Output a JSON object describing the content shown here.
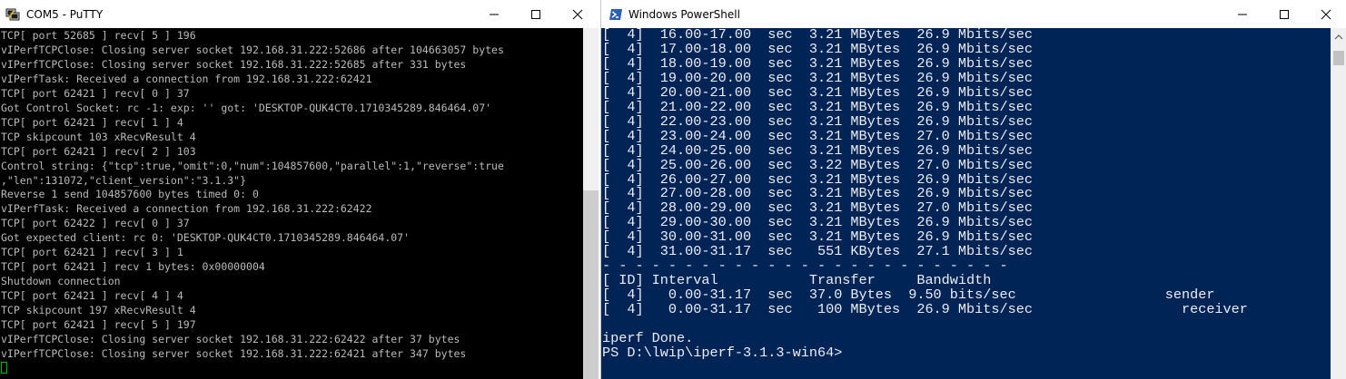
{
  "putty": {
    "title": "COM5 - PuTTY",
    "lines": [
      "TCP[ port 52685 ] recv[ 5 ] 196",
      "vIPerfTCPClose: Closing server socket 192.168.31.222:52686 after 104663057 bytes",
      "vIPerfTCPClose: Closing server socket 192.168.31.222:52685 after 331 bytes",
      "vIPerfTask: Received a connection from 192.168.31.222:62421",
      "TCP[ port 62421 ] recv[ 0 ] 37",
      "Got Control Socket: rc -1: exp: '' got: 'DESKTOP-QUK4CT0.1710345289.846464.07'",
      "TCP[ port 62421 ] recv[ 1 ] 4",
      "TCP skipcount 103 xRecvResult 4",
      "TCP[ port 62421 ] recv[ 2 ] 103",
      "Control string: {\"tcp\":true,\"omit\":0,\"num\":104857600,\"parallel\":1,\"reverse\":true",
      ",\"len\":131072,\"client_version\":\"3.1.3\"}",
      "Reverse 1 send 104857600 bytes timed 0: 0",
      "vIPerfTask: Received a connection from 192.168.31.222:62422",
      "TCP[ port 62422 ] recv[ 0 ] 37",
      "Got expected client: rc 0: 'DESKTOP-QUK4CT0.1710345289.846464.07'",
      "TCP[ port 62421 ] recv[ 3 ] 1",
      "TCP[ port 62421 ] recv 1 bytes: 0x00000004",
      "Shutdown connection",
      "TCP[ port 62421 ] recv[ 4 ] 4",
      "TCP skipcount 197 xRecvResult 4",
      "TCP[ port 62421 ] recv[ 5 ] 197",
      "vIPerfTCPClose: Closing server socket 192.168.31.222:62422 after 37 bytes",
      "vIPerfTCPClose: Closing server socket 192.168.31.222:62421 after 347 bytes"
    ]
  },
  "powershell": {
    "title": "Windows PowerShell",
    "lines": [
      "[  4]  16.00-17.00  sec  3.21 MBytes  26.9 Mbits/sec",
      "[  4]  17.00-18.00  sec  3.21 MBytes  26.9 Mbits/sec",
      "[  4]  18.00-19.00  sec  3.21 MBytes  26.9 Mbits/sec",
      "[  4]  19.00-20.00  sec  3.21 MBytes  26.9 Mbits/sec",
      "[  4]  20.00-21.00  sec  3.21 MBytes  26.9 Mbits/sec",
      "[  4]  21.00-22.00  sec  3.21 MBytes  26.9 Mbits/sec",
      "[  4]  22.00-23.00  sec  3.21 MBytes  26.9 Mbits/sec",
      "[  4]  23.00-24.00  sec  3.21 MBytes  27.0 Mbits/sec",
      "[  4]  24.00-25.00  sec  3.21 MBytes  26.9 Mbits/sec",
      "[  4]  25.00-26.00  sec  3.22 MBytes  27.0 Mbits/sec",
      "[  4]  26.00-27.00  sec  3.21 MBytes  26.9 Mbits/sec",
      "[  4]  27.00-28.00  sec  3.21 MBytes  26.9 Mbits/sec",
      "[  4]  28.00-29.00  sec  3.21 MBytes  27.0 Mbits/sec",
      "[  4]  29.00-30.00  sec  3.21 MBytes  26.9 Mbits/sec",
      "[  4]  30.00-31.00  sec  3.21 MBytes  26.9 Mbits/sec",
      "[  4]  31.00-31.17  sec   551 KBytes  27.1 Mbits/sec",
      "- - - - - - - - - - - - - - - - - - - - - - - - -",
      "[ ID] Interval           Transfer     Bandwidth",
      "[  4]   0.00-31.17  sec  37.0 Bytes  9.50 bits/sec                  sender",
      "[  4]   0.00-31.17  sec   100 MBytes  26.9 Mbits/sec                  receiver",
      "",
      "iperf Done.",
      "PS D:\\lwip\\iperf-3.1.3-win64>"
    ]
  }
}
